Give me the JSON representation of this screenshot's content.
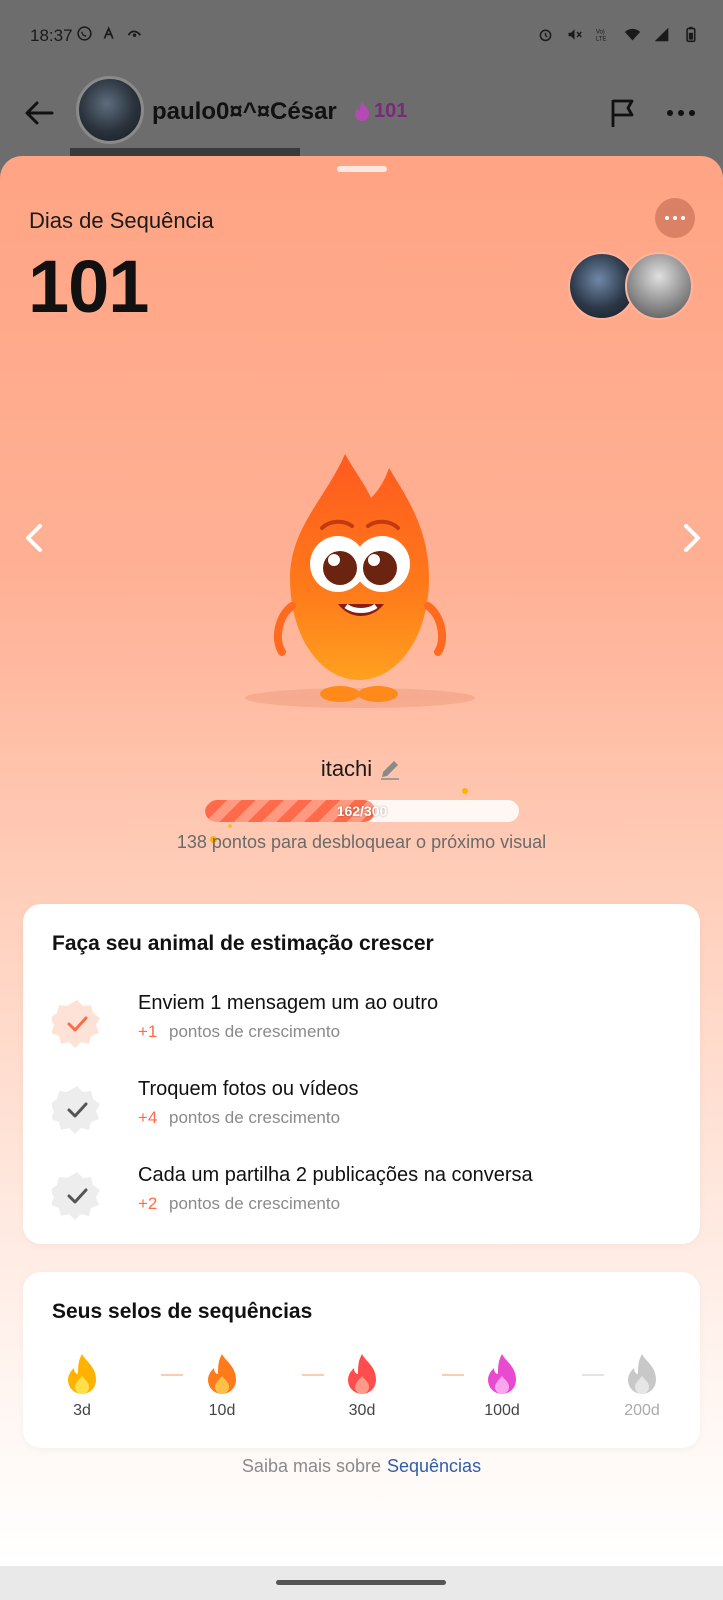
{
  "status_bar": {
    "time": "18:37",
    "left_icons": [
      "whatsapp-icon",
      "translate-icon",
      "app-icon"
    ],
    "right_icons": [
      "alarm-icon",
      "mute-icon",
      "volte-icon",
      "wifi-icon",
      "signal-icon",
      "battery-icon"
    ]
  },
  "chat_header": {
    "name": "paulo0¤^¤César",
    "streak_count": "101"
  },
  "sheet": {
    "label": "Dias de Sequência",
    "count": "101"
  },
  "pet": {
    "name": "itachi",
    "progress_text": "162/300",
    "progress_value": 162,
    "progress_max": 300,
    "unlock_text": "138 pontos para desbloquear o próximo visual"
  },
  "grow_card": {
    "title": "Faça seu animal de estimação crescer",
    "tasks": [
      {
        "title": "Enviem 1 mensagem um ao outro",
        "points": "+1",
        "points_label": "pontos de crescimento",
        "state": "done"
      },
      {
        "title": "Troquem fotos ou vídeos",
        "points": "+4",
        "points_label": "pontos de crescimento",
        "state": "pending"
      },
      {
        "title": "Cada um partilha 2 publicações na conversa",
        "points": "+2",
        "points_label": "pontos de crescimento",
        "state": "pending"
      }
    ]
  },
  "badges_card": {
    "title": "Seus selos de sequências",
    "badges": [
      {
        "label": "3d",
        "color": "#ffb300"
      },
      {
        "label": "10d",
        "color": "#ff7a1a"
      },
      {
        "label": "30d",
        "color": "#ff4d4d"
      },
      {
        "label": "100d",
        "color": "#e84bd0"
      },
      {
        "label": "200d",
        "color": "#c8c8c8"
      }
    ]
  },
  "footer": {
    "learn_more_text": "Saiba mais sobre",
    "learn_more_link": "Sequências"
  }
}
